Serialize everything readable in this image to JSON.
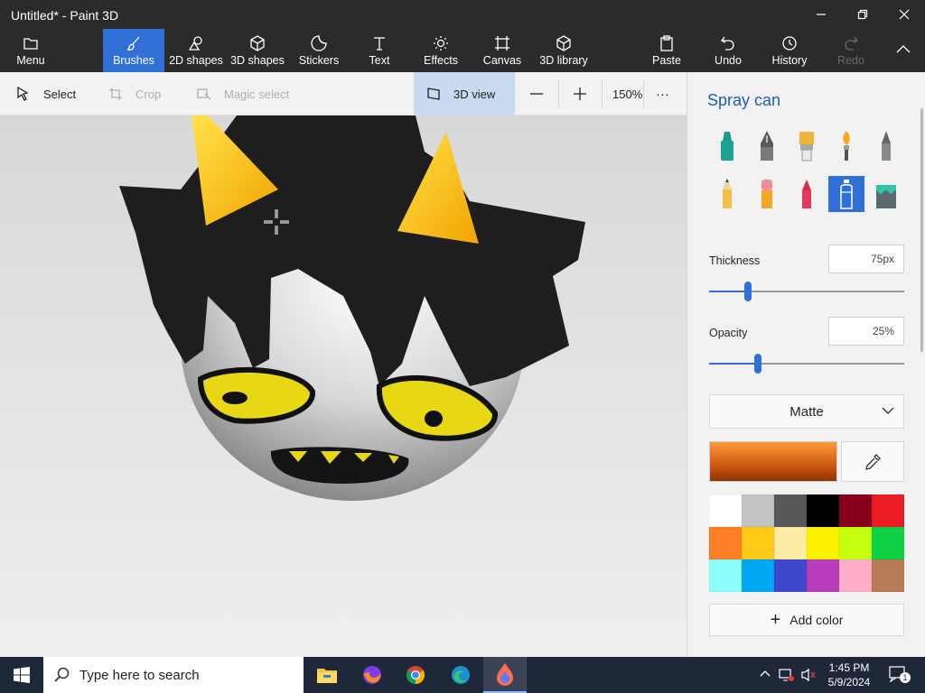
{
  "window": {
    "title": "Untitled* - Paint 3D"
  },
  "ribbon": {
    "menu": "Menu",
    "brushes": "Brushes",
    "shapes2d": "2D shapes",
    "shapes3d": "3D shapes",
    "stickers": "Stickers",
    "text": "Text",
    "effects": "Effects",
    "canvas": "Canvas",
    "library3d": "3D library",
    "paste": "Paste",
    "undo": "Undo",
    "history": "History",
    "redo": "Redo"
  },
  "toolbar": {
    "select": "Select",
    "crop": "Crop",
    "magic_select": "Magic select",
    "view3d": "3D view",
    "zoom": "150%",
    "more": "···"
  },
  "panel": {
    "title": "Spray can",
    "brushes": [
      "marker",
      "calligraphy-pen",
      "oil-brush",
      "watercolor",
      "pixel-pen",
      "pencil",
      "eraser",
      "crayon",
      "spray-can",
      "fill"
    ],
    "selected_brush": "spray-can",
    "thickness_label": "Thickness",
    "thickness_value": "75px",
    "thickness_level": 0.2,
    "opacity_label": "Opacity",
    "opacity_value": "25%",
    "opacity_level": 0.25,
    "material": "Matte",
    "current_color": "#d9631a",
    "palette": [
      "#ffffff",
      "#c3c3c3",
      "#585858",
      "#000000",
      "#88001b",
      "#ec1c24",
      "#ff7f27",
      "#ffca18",
      "#fdeca6",
      "#fff200",
      "#c4ff0e",
      "#0ed145",
      "#8cfffb",
      "#00a8f3",
      "#3f48cc",
      "#b83dba",
      "#ffaec8",
      "#b97a56"
    ],
    "add_color": "Add color"
  },
  "taskbar": {
    "search_placeholder": "Type here to search",
    "time": "1:45 PM",
    "date": "5/9/2024",
    "notification_count": "1"
  }
}
